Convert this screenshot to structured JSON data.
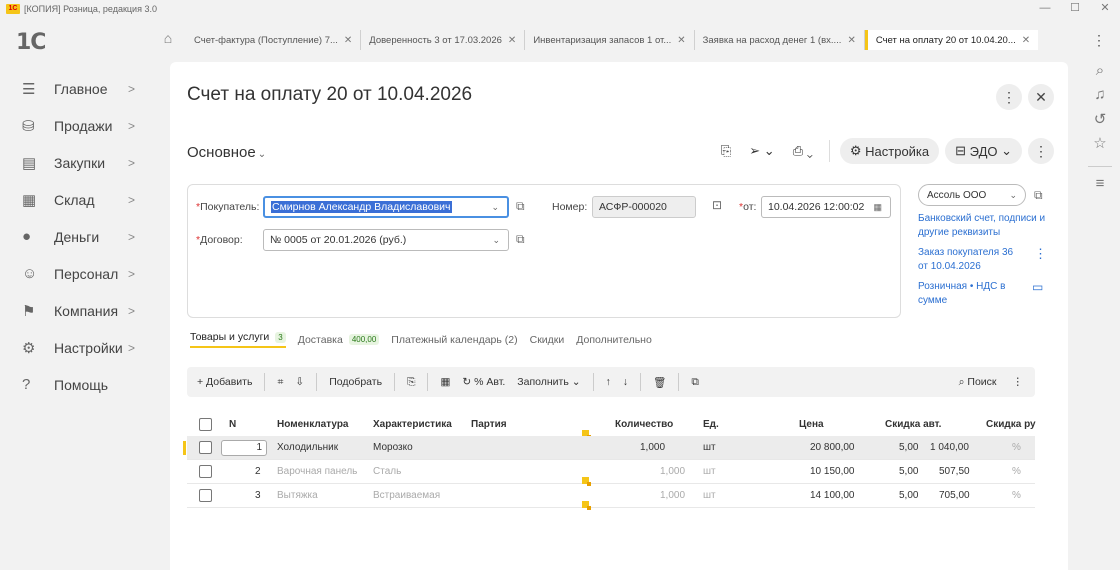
{
  "window": {
    "badge": "1С",
    "title": "[КОПИЯ] Розница, редакция 3.0",
    "controls": [
      "—",
      "☐",
      "✕"
    ]
  },
  "logo": "1С",
  "tabs": [
    {
      "label": "Счет-фактура (Поступление) 7..."
    },
    {
      "label": "Доверенность 3 от 17.03.2026"
    },
    {
      "label": "Инвентаризация запасов 1 от..."
    },
    {
      "label": "Заявка на расход денег 1 (вх...."
    },
    {
      "label": "Счет на оплату 20 от 10.04.20...",
      "active": true
    }
  ],
  "sidebar": {
    "items": [
      {
        "label": "Главное",
        "icon": "menu-icon"
      },
      {
        "label": "Продажи",
        "icon": "cart-icon"
      },
      {
        "label": "Закупки",
        "icon": "purchases-icon"
      },
      {
        "label": "Склад",
        "icon": "warehouse-icon"
      },
      {
        "label": "Деньги",
        "icon": "money-icon"
      },
      {
        "label": "Персонал",
        "icon": "people-icon"
      },
      {
        "label": "Компания",
        "icon": "flag-icon"
      },
      {
        "label": "Настройки",
        "icon": "gear-icon"
      },
      {
        "label": "Помощь",
        "icon": "help-icon"
      }
    ]
  },
  "document": {
    "title": "Счет на оплату 20 от 10.04.2026",
    "section": "Основное",
    "settings_label": "Настройка",
    "edo_label": "ЭДО"
  },
  "form": {
    "buyer_label": "Покупатель:",
    "buyer_value": "Смирнов Александр Владиславович",
    "contract_label": "Договор:",
    "contract_value": "№ 0005 от 20.01.2026 (руб.)",
    "number_label": "Номер:",
    "number_value": "АСФР-000020",
    "date_label": "от:",
    "date_value": "10.04.2026 12:00:02"
  },
  "side_info": {
    "organization": "Ассоль ООО",
    "bank_link": "Банковский счет, подписи и другие реквизиты",
    "order_link": "Заказ покупателя 36 от 10.04.2026",
    "tax_link": "Розничная • НДС в сумме"
  },
  "doc_tabs": [
    {
      "label": "Товары и услуги",
      "badge": "3",
      "active": true
    },
    {
      "label": "Доставка",
      "badge": "400,00"
    },
    {
      "label": "Платежный календарь (2)"
    },
    {
      "label": "Скидки"
    },
    {
      "label": "Дополнительно"
    }
  ],
  "table_toolbar": {
    "add": "+ Добавить",
    "pick": "Подобрать",
    "auto_pct": "% Авт.",
    "fill": "Заполнить",
    "search": "Поиск"
  },
  "table": {
    "columns": {
      "n": "N",
      "item": "Номенклатура",
      "char": "Характеристика",
      "batch": "Партия",
      "qty": "Количество",
      "unit": "Ед.",
      "price": "Цена",
      "disc_auto": "Скидка авт.",
      "disc_manual": "Скидка ру"
    },
    "rows": [
      {
        "n": "1",
        "item": "Холодильник",
        "char": "Морозко",
        "qty": "1,000",
        "unit": "шт",
        "price": "20 800,00",
        "disc_pct": "5,00",
        "disc_sum": "1 040,00",
        "pct": "%"
      },
      {
        "n": "2",
        "item": "Варочная панель",
        "char": "Сталь",
        "qty": "1,000",
        "unit": "шт",
        "price": "10 150,00",
        "disc_pct": "5,00",
        "disc_sum": "507,50",
        "pct": "%"
      },
      {
        "n": "3",
        "item": "Вытяжка",
        "char": "Встраиваемая",
        "qty": "1,000",
        "unit": "шт",
        "price": "14 100,00",
        "disc_pct": "5,00",
        "disc_sum": "705,00",
        "pct": "%"
      }
    ]
  }
}
